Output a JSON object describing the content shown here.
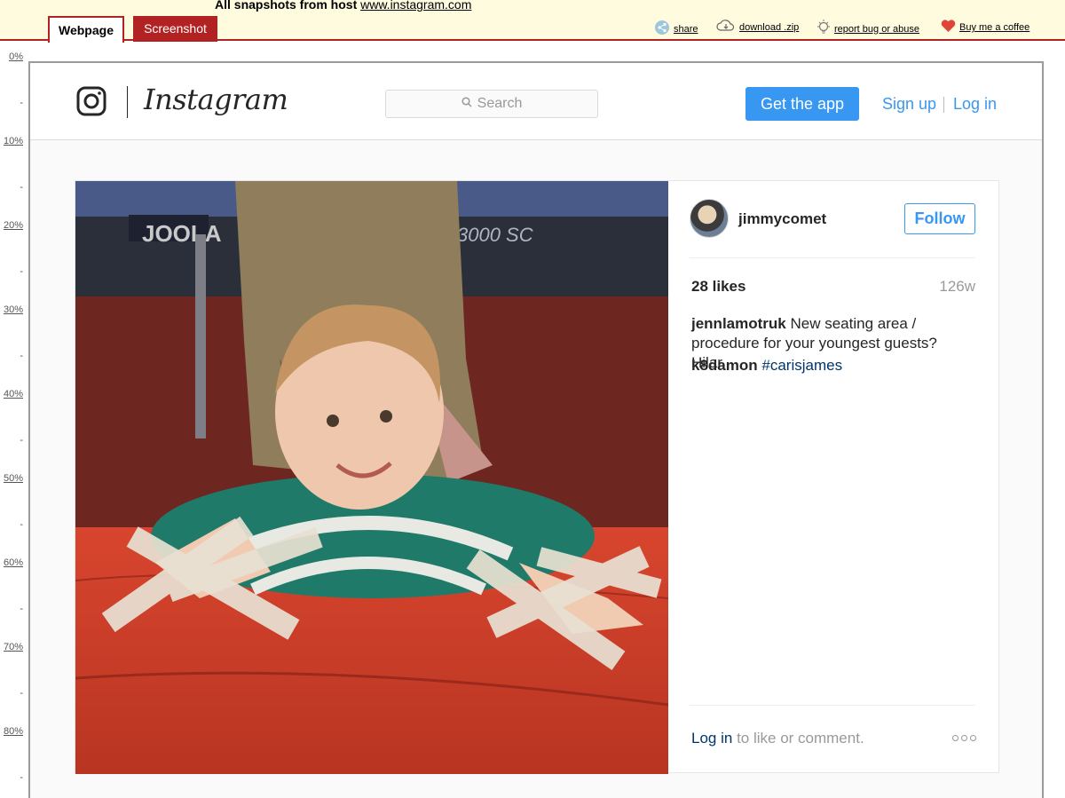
{
  "archive": {
    "title_prefix": "All snapshots  from host",
    "host": "www.instagram.com",
    "tabs": {
      "webpage": "Webpage",
      "screenshot": "Screenshot"
    },
    "links": {
      "share": "share",
      "download": "download .zip",
      "report": "report bug or abuse",
      "coffee": "Buy me a coffee"
    },
    "ruler": [
      "0%",
      "-",
      "10%",
      "-",
      "20%",
      "-",
      "30%",
      "-",
      "40%",
      "-",
      "50%",
      "-",
      "60%",
      "-",
      "70%",
      "-",
      "80%",
      "-"
    ]
  },
  "header": {
    "wordmark": "Instagram",
    "search_placeholder": "Search",
    "get_app": "Get the app",
    "sign_up": "Sign up",
    "log_in": "Log in"
  },
  "post": {
    "username": "jimmycomet",
    "follow_label": "Follow",
    "likes": "28 likes",
    "age": "126w",
    "caption_user": "jennlamotruk",
    "caption_text": "New seating area / procedure for your youngest guests? Hilar.",
    "comment_user": "k8damon",
    "comment_tag": "#carisjames",
    "login_link": "Log in",
    "login_rest": "to like or comment."
  },
  "colors": {
    "accent": "#3897f0",
    "archive_red": "#b22222"
  }
}
